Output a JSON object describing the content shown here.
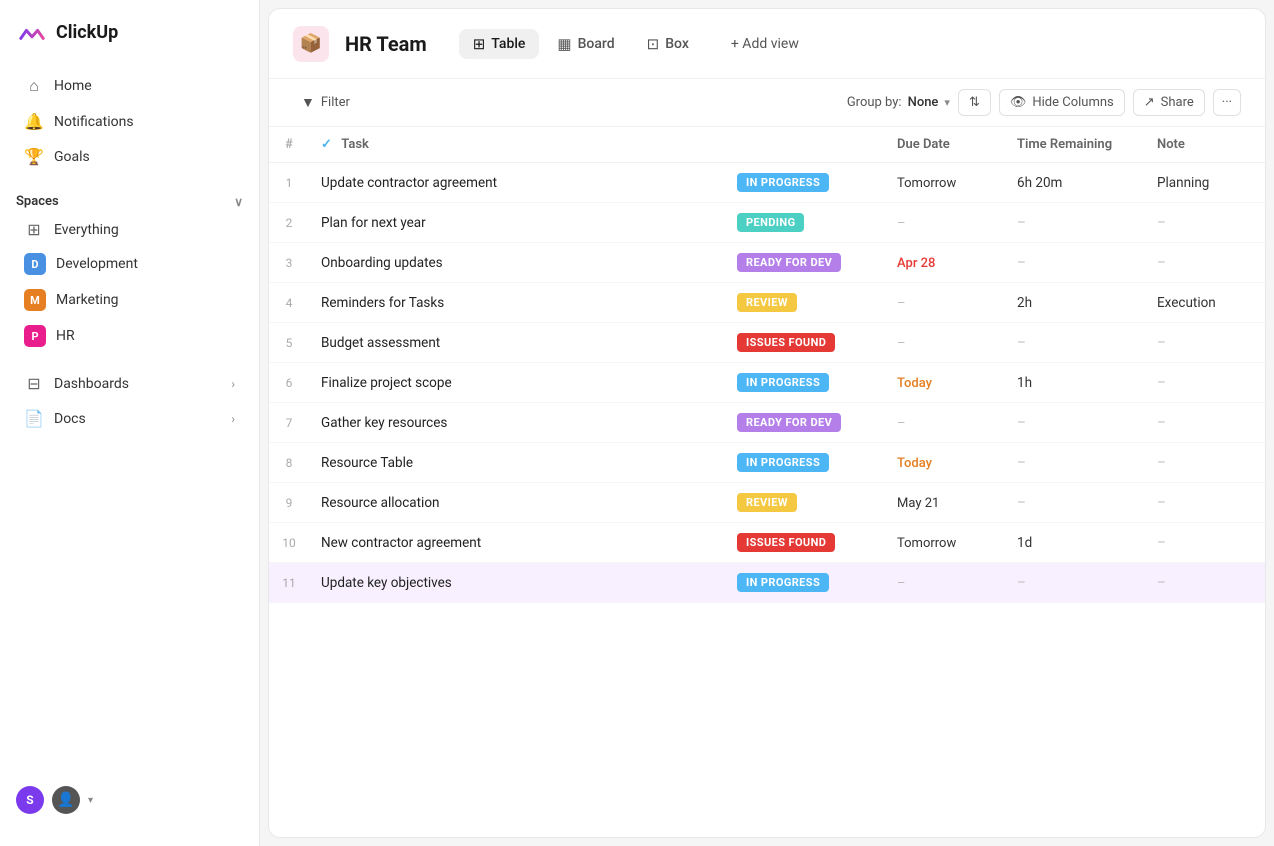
{
  "app": {
    "name": "ClickUp"
  },
  "sidebar": {
    "nav": [
      {
        "id": "home",
        "label": "Home",
        "icon": "⌂"
      },
      {
        "id": "notifications",
        "label": "Notifications",
        "icon": "🔔"
      },
      {
        "id": "goals",
        "label": "Goals",
        "icon": "🏆"
      }
    ],
    "spaces_label": "Spaces",
    "everything_label": "Everything",
    "spaces": [
      {
        "id": "development",
        "label": "Development",
        "initial": "D",
        "color": "badge-d"
      },
      {
        "id": "marketing",
        "label": "Marketing",
        "initial": "M",
        "color": "badge-m"
      },
      {
        "id": "hr",
        "label": "HR",
        "initial": "P",
        "color": "badge-hr"
      }
    ],
    "dashboards_label": "Dashboards",
    "docs_label": "Docs"
  },
  "header": {
    "project_name": "HR Team",
    "tabs": [
      {
        "id": "table",
        "label": "Table",
        "icon": "⊞",
        "active": true
      },
      {
        "id": "board",
        "label": "Board",
        "icon": "▦"
      },
      {
        "id": "box",
        "label": "Box",
        "icon": "⊡"
      }
    ],
    "add_view_label": "+ Add view"
  },
  "toolbar": {
    "filter_label": "Filter",
    "group_by_label": "Group by:",
    "group_by_value": "None",
    "sort_icon": "⇅",
    "hide_columns_label": "Hide Columns",
    "share_label": "Share",
    "more_icon": "···"
  },
  "table": {
    "columns": [
      "#",
      "✓  Task",
      "",
      "Due Date",
      "Time Remaining",
      "Note"
    ],
    "rows": [
      {
        "num": 1,
        "task": "Update contractor agreement",
        "status": "IN PROGRESS",
        "status_class": "status-in-progress",
        "due_date": "Tomorrow",
        "due_class": "",
        "time_remaining": "6h 20m",
        "note": "Planning"
      },
      {
        "num": 2,
        "task": "Plan for next year",
        "status": "PENDING",
        "status_class": "status-pending",
        "due_date": "–",
        "due_class": "dash",
        "time_remaining": "–",
        "note": "–"
      },
      {
        "num": 3,
        "task": "Onboarding updates",
        "status": "READY FOR DEV",
        "status_class": "status-ready-for-dev",
        "due_date": "Apr 28",
        "due_class": "due-overdue",
        "time_remaining": "–",
        "note": "–"
      },
      {
        "num": 4,
        "task": "Reminders for Tasks",
        "status": "REVIEW",
        "status_class": "status-review",
        "due_date": "–",
        "due_class": "dash",
        "time_remaining": "2h",
        "note": "Execution"
      },
      {
        "num": 5,
        "task": "Budget assessment",
        "status": "ISSUES FOUND",
        "status_class": "status-issues-found",
        "due_date": "–",
        "due_class": "dash",
        "time_remaining": "–",
        "note": "–"
      },
      {
        "num": 6,
        "task": "Finalize project scope",
        "status": "IN PROGRESS",
        "status_class": "status-in-progress",
        "due_date": "Today",
        "due_class": "due-today",
        "time_remaining": "1h",
        "note": "–"
      },
      {
        "num": 7,
        "task": "Gather key resources",
        "status": "READY FOR DEV",
        "status_class": "status-ready-for-dev",
        "due_date": "–",
        "due_class": "dash",
        "time_remaining": "–",
        "note": "–"
      },
      {
        "num": 8,
        "task": "Resource Table",
        "status": "IN PROGRESS",
        "status_class": "status-in-progress",
        "due_date": "Today",
        "due_class": "due-today",
        "time_remaining": "–",
        "note": "–"
      },
      {
        "num": 9,
        "task": "Resource allocation",
        "status": "REVIEW",
        "status_class": "status-review",
        "due_date": "May 21",
        "due_class": "",
        "time_remaining": "–",
        "note": "–"
      },
      {
        "num": 10,
        "task": "New contractor agreement",
        "status": "ISSUES FOUND",
        "status_class": "status-issues-found",
        "due_date": "Tomorrow",
        "due_class": "",
        "time_remaining": "1d",
        "note": "–"
      },
      {
        "num": 11,
        "task": "Update key objectives",
        "status": "IN PROGRESS",
        "status_class": "status-in-progress",
        "due_date": "–",
        "due_class": "dash",
        "time_remaining": "–",
        "note": "–",
        "selected": true
      }
    ]
  }
}
